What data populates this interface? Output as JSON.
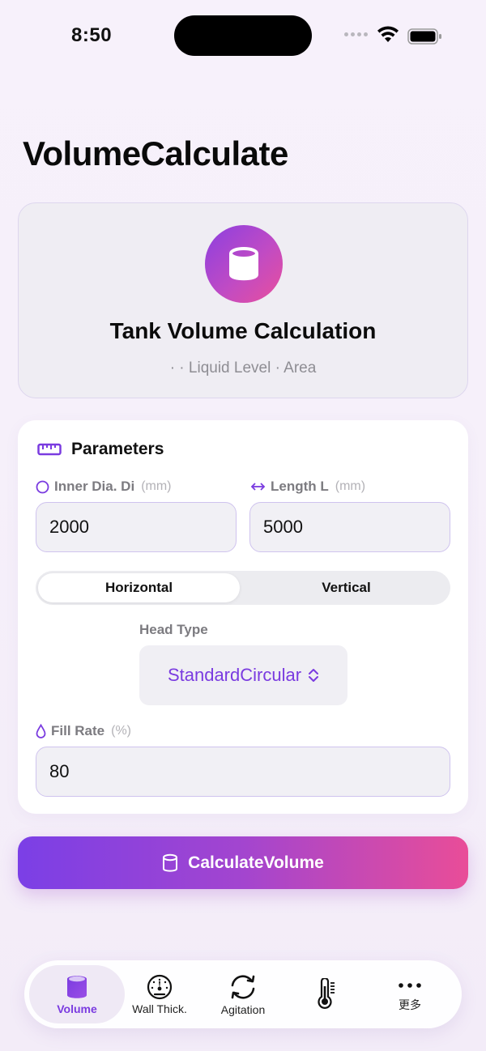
{
  "status_bar": {
    "time": "8:50"
  },
  "page": {
    "title": "VolumeCalculate"
  },
  "hero": {
    "title": "Tank Volume Calculation",
    "subtitle": "·  · Liquid Level · Area",
    "icon": "cylinder-icon"
  },
  "parameters": {
    "title": "Parameters",
    "inner_dia": {
      "label": "Inner Dia. Di",
      "unit": "(mm)",
      "value": "2000"
    },
    "length": {
      "label": "Length L",
      "unit": "(mm)",
      "value": "5000"
    },
    "orientation": {
      "options": [
        "Horizontal",
        "Vertical"
      ],
      "selected": "Horizontal"
    },
    "head_type": {
      "label": "Head Type",
      "value": "StandardCircular"
    },
    "fill_rate": {
      "label": "Fill Rate",
      "unit": "(%)",
      "value": "80"
    }
  },
  "calculate_button": {
    "label": "CalculateVolume"
  },
  "tab_bar": {
    "items": [
      {
        "label": "Volume",
        "icon": "cylinder-icon",
        "active": true
      },
      {
        "label": "Wall Thick.",
        "icon": "gauge-icon",
        "active": false
      },
      {
        "label": "Agitation",
        "icon": "refresh-icon",
        "active": false
      },
      {
        "label": "",
        "icon": "thermometer-icon",
        "active": false
      },
      {
        "label": "更多",
        "icon": "more-icon",
        "active": false
      }
    ]
  },
  "colors": {
    "accent": "#7a3be0",
    "gradient_start": "#7b3fe6",
    "gradient_end": "#e94d98"
  }
}
